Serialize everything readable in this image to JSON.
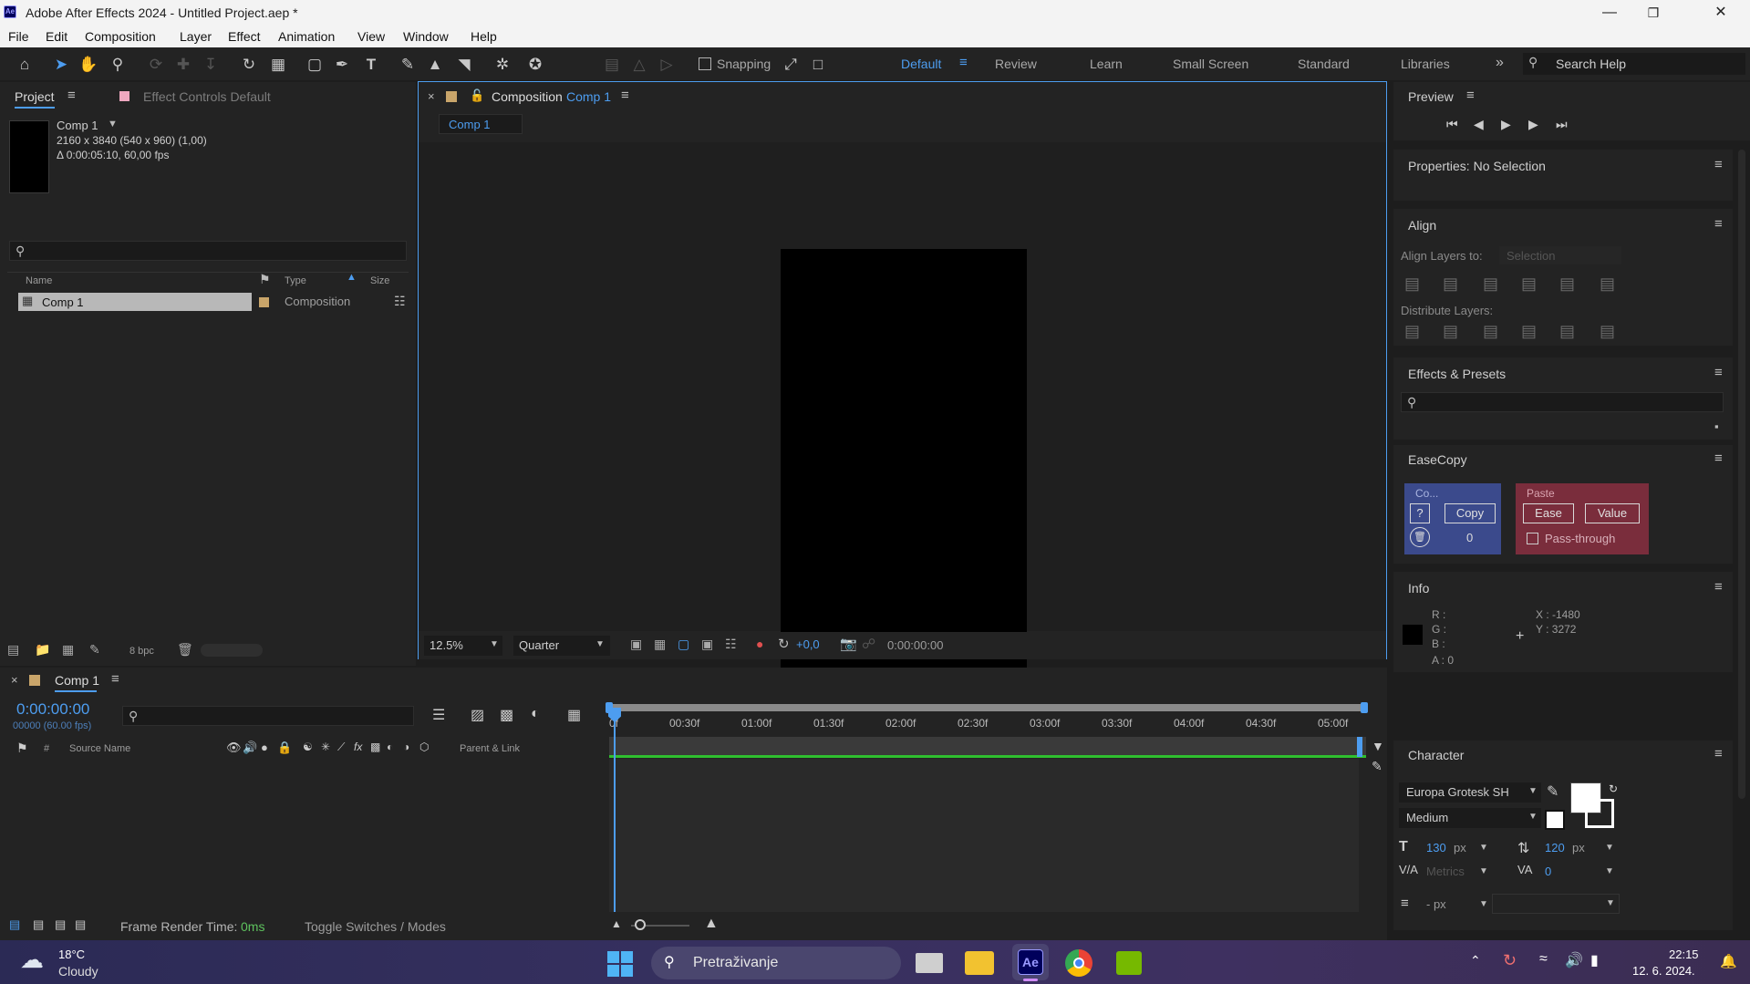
{
  "window": {
    "title": "Adobe After Effects 2024 - Untitled Project.aep *",
    "app_icon": "Ae",
    "controls": [
      "minimize-icon",
      "restore-icon",
      "close-icon"
    ]
  },
  "menu": [
    "File",
    "Edit",
    "Composition",
    "Layer",
    "Effect",
    "Animation",
    "View",
    "Window",
    "Help"
  ],
  "toolbar": {
    "snapping_label": "Snapping",
    "workspaces": [
      "Default",
      "Review",
      "Learn",
      "Small Screen",
      "Standard",
      "Libraries"
    ],
    "active_workspace": "Default",
    "search_placeholder": "Search Help"
  },
  "project_panel": {
    "tab": "Project",
    "effect_controls_tab": "Effect Controls Default",
    "comp_name": "Comp 1",
    "comp_res": "2160 x 3840  (540 x 960) (1,00)",
    "comp_duration": "Δ 0:00:05:10, 60,00 fps",
    "columns": {
      "name": "Name",
      "type": "Type",
      "size": "Size"
    },
    "items": [
      {
        "name": "Comp 1",
        "type": "Composition"
      }
    ],
    "bpc": "8 bpc"
  },
  "comp_viewer": {
    "tab_prefix": "Composition",
    "tab_name": "Comp 1",
    "breadcrumb": "Comp 1",
    "zoom": "12.5%",
    "resolution": "Quarter",
    "exposure": "+0,0",
    "timecode": "0:00:00:00"
  },
  "right_panels": {
    "preview": "Preview",
    "properties": "Properties: No Selection",
    "align": "Align",
    "align_layers_to": "Align Layers to:",
    "align_selection": "Selection",
    "distribute_layers": "Distribute Layers:",
    "effects_presets": "Effects & Presets",
    "easecopy": {
      "title": "EaseCopy",
      "copy_group": "Co...",
      "help": "?",
      "copy": "Copy",
      "count": "0",
      "paste_group": "Paste",
      "ease": "Ease",
      "value": "Value",
      "pass_through": "Pass-through"
    },
    "info": {
      "title": "Info",
      "r": "R :",
      "g": "G :",
      "b": "B :",
      "a": "A : 0",
      "x": "X : -1480",
      "y": "Y : 3272"
    },
    "character": {
      "title": "Character",
      "font": "Europa Grotesk SH",
      "style": "Medium",
      "size": "130",
      "leading": "120",
      "unit": "px",
      "kerning": "Metrics",
      "tracking": "0",
      "stroke": "- px"
    }
  },
  "timeline": {
    "tab": "Comp 1",
    "timecode": "0:00:00:00",
    "frame_info": "00000 (60.00 fps)",
    "col_hash": "#",
    "col_source": "Source Name",
    "col_parent": "Parent & Link",
    "ruler": [
      "0f",
      "00:30f",
      "01:00f",
      "01:30f",
      "02:00f",
      "02:30f",
      "03:00f",
      "03:30f",
      "04:00f",
      "04:30f",
      "05:00f"
    ],
    "frame_render_label": "Frame Render Time:",
    "frame_render_value": "0ms",
    "toggle_label": "Toggle Switches / Modes"
  },
  "taskbar": {
    "temp": "18°C",
    "weather": "Cloudy",
    "search": "Pretraživanje",
    "time": "22:15",
    "date": "12. 6. 2024.",
    "ae_label": "Ae"
  },
  "colors": {
    "accent": "#4d9df0",
    "panel": "#232323",
    "easecopy_copy": "#3b4a8c",
    "easecopy_paste": "#7a2d3c",
    "timeline_green": "#2fbf2f"
  }
}
